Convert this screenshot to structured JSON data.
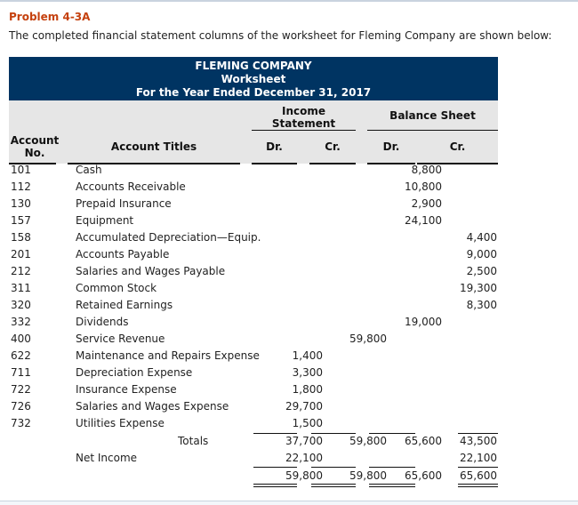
{
  "problem_title": "Problem 4-3A",
  "intro": "The completed financial statement columns of the worksheet for Fleming Company are shown below:",
  "worksheet": {
    "company": "FLEMING COMPANY",
    "title": "Worksheet",
    "period": "For the Year Ended December 31, 2017",
    "headers": {
      "account_no": [
        "Account",
        "No."
      ],
      "account_titles": "Account Titles",
      "income_statement": [
        "Income",
        "Statement"
      ],
      "balance_sheet": "Balance Sheet",
      "dr": "Dr.",
      "cr": "Cr."
    },
    "rows": [
      {
        "no": "101",
        "title": "Cash",
        "is_dr": "",
        "is_cr": "",
        "bs_dr": "8,800",
        "bs_cr": ""
      },
      {
        "no": "112",
        "title": "Accounts Receivable",
        "is_dr": "",
        "is_cr": "",
        "bs_dr": "10,800",
        "bs_cr": ""
      },
      {
        "no": "130",
        "title": "Prepaid Insurance",
        "is_dr": "",
        "is_cr": "",
        "bs_dr": "2,900",
        "bs_cr": ""
      },
      {
        "no": "157",
        "title": "Equipment",
        "is_dr": "",
        "is_cr": "",
        "bs_dr": "24,100",
        "bs_cr": ""
      },
      {
        "no": "158",
        "title": "Accumulated Depreciation—Equip.",
        "is_dr": "",
        "is_cr": "",
        "bs_dr": "",
        "bs_cr": "4,400"
      },
      {
        "no": "201",
        "title": "Accounts Payable",
        "is_dr": "",
        "is_cr": "",
        "bs_dr": "",
        "bs_cr": "9,000"
      },
      {
        "no": "212",
        "title": "Salaries and Wages Payable",
        "is_dr": "",
        "is_cr": "",
        "bs_dr": "",
        "bs_cr": "2,500"
      },
      {
        "no": "311",
        "title": "Common Stock",
        "is_dr": "",
        "is_cr": "",
        "bs_dr": "",
        "bs_cr": "19,300"
      },
      {
        "no": "320",
        "title": "Retained Earnings",
        "is_dr": "",
        "is_cr": "",
        "bs_dr": "",
        "bs_cr": "8,300"
      },
      {
        "no": "332",
        "title": "Dividends",
        "is_dr": "",
        "is_cr": "",
        "bs_dr": "19,000",
        "bs_cr": ""
      },
      {
        "no": "400",
        "title": "Service Revenue",
        "is_dr": "",
        "is_cr": "59,800",
        "bs_dr": "",
        "bs_cr": ""
      },
      {
        "no": "622",
        "title": "Maintenance and Repairs Expense",
        "is_dr": "1,400",
        "is_cr": "",
        "bs_dr": "",
        "bs_cr": ""
      },
      {
        "no": "711",
        "title": "Depreciation Expense",
        "is_dr": "3,300",
        "is_cr": "",
        "bs_dr": "",
        "bs_cr": ""
      },
      {
        "no": "722",
        "title": "Insurance Expense",
        "is_dr": "1,800",
        "is_cr": "",
        "bs_dr": "",
        "bs_cr": ""
      },
      {
        "no": "726",
        "title": "Salaries and Wages Expense",
        "is_dr": "29,700",
        "is_cr": "",
        "bs_dr": "",
        "bs_cr": ""
      },
      {
        "no": "732",
        "title": "Utilities Expense",
        "is_dr": "1,500",
        "is_cr": "",
        "bs_dr": "",
        "bs_cr": ""
      }
    ],
    "totals": {
      "label": "Totals",
      "is_dr": "37,700",
      "is_cr": "59,800",
      "bs_dr": "65,600",
      "bs_cr": "43,500"
    },
    "net_income": {
      "label": "Net Income",
      "is_dr": "22,100",
      "is_cr": "",
      "bs_dr": "",
      "bs_cr": "22,100"
    },
    "grand_totals": {
      "is_dr": "59,800",
      "is_cr": "59,800",
      "bs_dr": "65,600",
      "bs_cr": "65,600"
    }
  }
}
